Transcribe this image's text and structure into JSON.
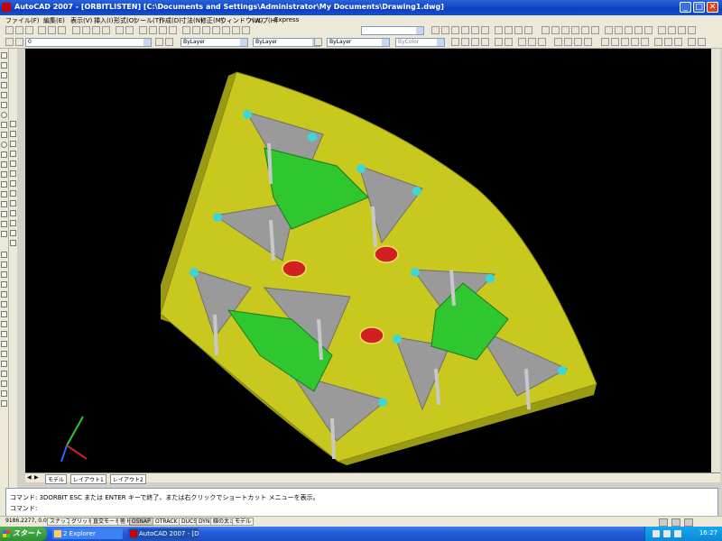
{
  "window": {
    "title": "AutoCAD 2007 - [ORBITLISTEN]  [C:\\Documents and Settings\\Administrator\\My Documents\\Drawing1.dwg]",
    "min_label": "_",
    "max_label": "□",
    "close_label": "✕"
  },
  "menu": {
    "items": [
      "ファイル(F)",
      "編集(E)",
      "表示(V)",
      "挿入(I)",
      "形式(O)",
      "ツール(T)",
      "作成(D)",
      "寸法(N)",
      "修正(M)",
      "ウィンドウ(W)",
      "ヘルプ(H)",
      "Express"
    ]
  },
  "toolbar": {
    "layer_value": "0",
    "color_value": "ByLayer",
    "linetype_value": "ByLayer",
    "lineweight_value": "ByLayer",
    "plotstyle_value": "ByColor",
    "workspace_value": ""
  },
  "layout_tabs": {
    "items": [
      "モデル",
      "レイアウト1",
      "レイアウト2"
    ]
  },
  "command": {
    "line1": "コマンド: 3DORBIT    ESC または ENTER キーで終了、または右クリックでショートカット メニューを表示。",
    "line2": "コマンド:"
  },
  "status": {
    "coords": "9186.2277, 0.0000",
    "buttons": [
      {
        "label": "スナップ",
        "on": false
      },
      {
        "label": "グリッド",
        "on": false
      },
      {
        "label": "直交モード",
        "on": false
      },
      {
        "label": "極トラッキング",
        "on": false
      },
      {
        "label": "OSNAP",
        "on": true
      },
      {
        "label": "OTRACK",
        "on": false
      },
      {
        "label": "DUCS",
        "on": false
      },
      {
        "label": "DYN",
        "on": false
      },
      {
        "label": "線の太さ",
        "on": false
      },
      {
        "label": "モデル",
        "on": false
      }
    ]
  },
  "taskbar": {
    "start_label": "スタート",
    "tasks": [
      {
        "label": "2 Explorer",
        "active": false
      },
      {
        "label": "AutoCAD 2007 - [Dr...",
        "active": true
      }
    ],
    "clock": "16:27"
  },
  "colors": {
    "plate": "#c8c81e",
    "plate_edge": "#9a9a14",
    "bracket": "#2fc62f",
    "gray_part": "#9a9a9a",
    "red_part": "#d22020",
    "accent_cyan": "#3fd6d6"
  }
}
